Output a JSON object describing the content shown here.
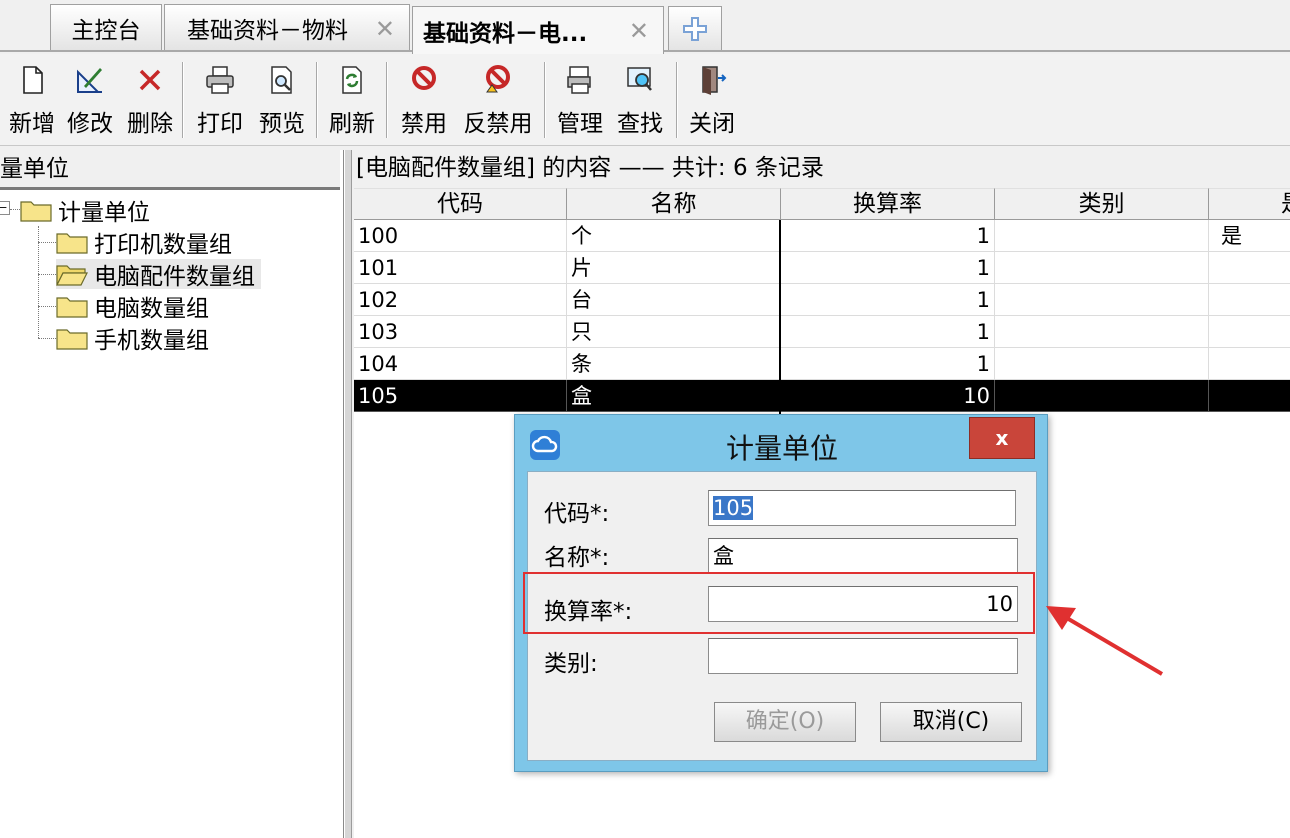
{
  "tabs": [
    {
      "label": "主控台",
      "closable": false
    },
    {
      "label": "基础资料－物料",
      "closable": true
    },
    {
      "label": "基础资料－电...",
      "closable": true,
      "active": true
    }
  ],
  "toolbar": {
    "new": "新增",
    "edit": "修改",
    "delete": "删除",
    "print": "打印",
    "preview": "预览",
    "refresh": "刷新",
    "disable": "禁用",
    "undisable": "反禁用",
    "manage": "管理",
    "find": "查找",
    "close": "关闭"
  },
  "tree": {
    "pane_title": "量单位",
    "root": "计量单位",
    "children": [
      "打印机数量组",
      "电脑配件数量组",
      "电脑数量组",
      "手机数量组"
    ]
  },
  "grid": {
    "caption": "[电脑配件数量组] 的内容 —— 共计: 6 条记录",
    "columns": [
      "代码",
      "名称",
      "换算率",
      "类别",
      "是"
    ],
    "rows": [
      {
        "code": "100",
        "name": "个",
        "rate": "1",
        "category": "",
        "flag": "是"
      },
      {
        "code": "101",
        "name": "片",
        "rate": "1",
        "category": "",
        "flag": ""
      },
      {
        "code": "102",
        "name": "台",
        "rate": "1",
        "category": "",
        "flag": ""
      },
      {
        "code": "103",
        "name": "只",
        "rate": "1",
        "category": "",
        "flag": ""
      },
      {
        "code": "104",
        "name": "条",
        "rate": "1",
        "category": "",
        "flag": ""
      },
      {
        "code": "105",
        "name": "盒",
        "rate": "10",
        "category": "",
        "flag": ""
      }
    ]
  },
  "dialog": {
    "title": "计量单位",
    "close_label": "x",
    "code_label": "代码*:",
    "code_value": "105",
    "name_label": "名称*:",
    "name_value": "盒",
    "rate_label": "换算率*:",
    "rate_value": "10",
    "category_label": "类别:",
    "category_value": "",
    "ok_button": "确定(O)",
    "cancel_button": "取消(C)"
  },
  "colors": {
    "dialog_frame": "#7ec6e8",
    "close_button": "#c9453a",
    "highlight": "#3a77c8",
    "annotation": "#e03030",
    "selected_row": "#000000"
  }
}
